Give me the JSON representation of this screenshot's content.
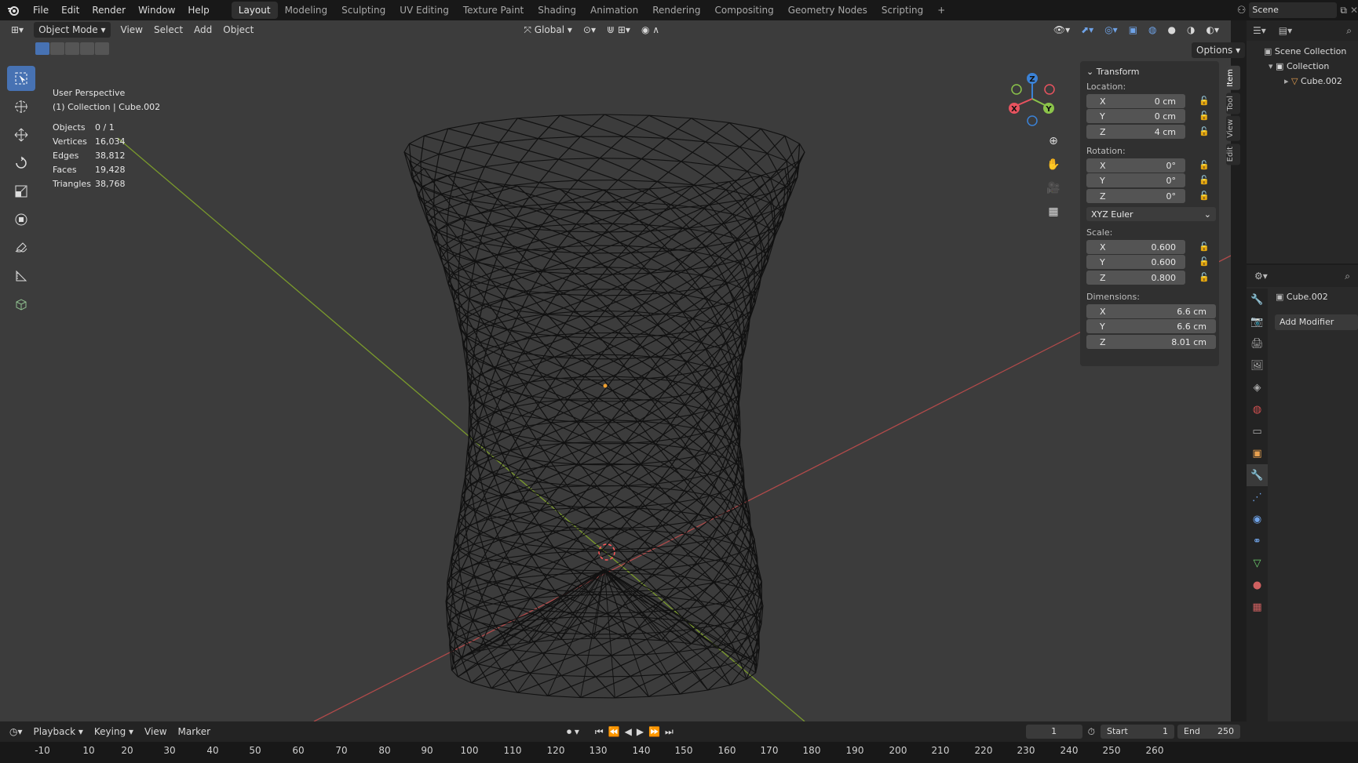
{
  "topbar": {
    "menus": [
      "File",
      "Edit",
      "Render",
      "Window",
      "Help"
    ],
    "workspaces": [
      "Layout",
      "Modeling",
      "Sculpting",
      "UV Editing",
      "Texture Paint",
      "Shading",
      "Animation",
      "Rendering",
      "Compositing",
      "Geometry Nodes",
      "Scripting"
    ],
    "active_workspace": "Layout",
    "add_tab": "+",
    "scene": "Scene"
  },
  "viewport_header": {
    "mode": "Object Mode",
    "menus": [
      "View",
      "Select",
      "Add",
      "Object"
    ],
    "orientation": "Global",
    "options": "Options"
  },
  "overlay": {
    "view_name": "User Perspective",
    "collection_info": "(1) Collection | Cube.002",
    "stats": [
      {
        "label": "Objects",
        "value": "0 / 1"
      },
      {
        "label": "Vertices",
        "value": "16,034"
      },
      {
        "label": "Edges",
        "value": "38,812"
      },
      {
        "label": "Faces",
        "value": "19,428"
      },
      {
        "label": "Triangles",
        "value": "38,768"
      }
    ]
  },
  "gizmo": {
    "x": "X",
    "y": "Y",
    "z": "Z"
  },
  "npanel": {
    "section": "Transform",
    "location_label": "Location:",
    "location": [
      {
        "axis": "X",
        "value": "0 cm"
      },
      {
        "axis": "Y",
        "value": "0 cm"
      },
      {
        "axis": "Z",
        "value": "4 cm"
      }
    ],
    "rotation_label": "Rotation:",
    "rotation": [
      {
        "axis": "X",
        "value": "0°"
      },
      {
        "axis": "Y",
        "value": "0°"
      },
      {
        "axis": "Z",
        "value": "0°"
      }
    ],
    "rotation_mode": "XYZ Euler",
    "scale_label": "Scale:",
    "scale": [
      {
        "axis": "X",
        "value": "0.600"
      },
      {
        "axis": "Y",
        "value": "0.600"
      },
      {
        "axis": "Z",
        "value": "0.800"
      }
    ],
    "dimensions_label": "Dimensions:",
    "dimensions": [
      {
        "axis": "X",
        "value": "6.6 cm"
      },
      {
        "axis": "Y",
        "value": "6.6 cm"
      },
      {
        "axis": "Z",
        "value": "8.01 cm"
      }
    ],
    "tabs": [
      "Item",
      "Tool",
      "View",
      "Edit"
    ]
  },
  "outliner": {
    "scene_collection": "Scene Collection",
    "collection": "Collection",
    "object": "Cube.002"
  },
  "properties": {
    "object_name": "Cube.002",
    "add_modifier": "Add Modifier"
  },
  "timeline": {
    "menus": [
      "Playback",
      "Keying",
      "View",
      "Marker"
    ],
    "current_frame": "1",
    "start_label": "Start",
    "start": "1",
    "end_label": "End",
    "end": "250",
    "ruler": [
      "-10",
      "10",
      "20",
      "30",
      "40",
      "50",
      "60",
      "70",
      "80",
      "90",
      "100",
      "110",
      "120",
      "130",
      "140",
      "150",
      "160",
      "170",
      "180",
      "190",
      "200",
      "210",
      "220",
      "230",
      "240",
      "250",
      "260"
    ],
    "playhead": "1"
  },
  "colors": {
    "accent": "#4772b3",
    "x_axis": "#e8535f",
    "y_axis": "#8bc34a",
    "z_axis": "#3b82d6"
  }
}
